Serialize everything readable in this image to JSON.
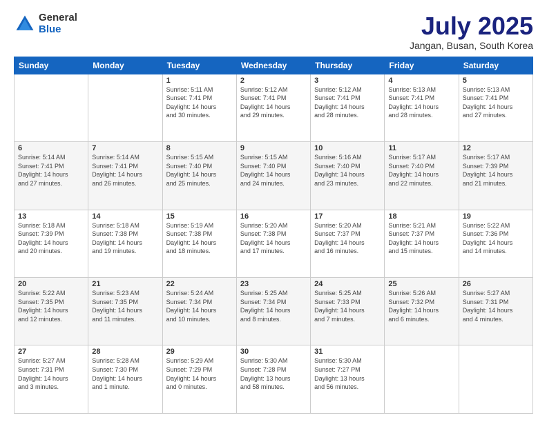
{
  "logo": {
    "general": "General",
    "blue": "Blue"
  },
  "title": "July 2025",
  "location": "Jangan, Busan, South Korea",
  "days_of_week": [
    "Sunday",
    "Monday",
    "Tuesday",
    "Wednesday",
    "Thursday",
    "Friday",
    "Saturday"
  ],
  "weeks": [
    [
      {
        "day": "",
        "content": ""
      },
      {
        "day": "",
        "content": ""
      },
      {
        "day": "1",
        "content": "Sunrise: 5:11 AM\nSunset: 7:41 PM\nDaylight: 14 hours\nand 30 minutes."
      },
      {
        "day": "2",
        "content": "Sunrise: 5:12 AM\nSunset: 7:41 PM\nDaylight: 14 hours\nand 29 minutes."
      },
      {
        "day": "3",
        "content": "Sunrise: 5:12 AM\nSunset: 7:41 PM\nDaylight: 14 hours\nand 28 minutes."
      },
      {
        "day": "4",
        "content": "Sunrise: 5:13 AM\nSunset: 7:41 PM\nDaylight: 14 hours\nand 28 minutes."
      },
      {
        "day": "5",
        "content": "Sunrise: 5:13 AM\nSunset: 7:41 PM\nDaylight: 14 hours\nand 27 minutes."
      }
    ],
    [
      {
        "day": "6",
        "content": "Sunrise: 5:14 AM\nSunset: 7:41 PM\nDaylight: 14 hours\nand 27 minutes."
      },
      {
        "day": "7",
        "content": "Sunrise: 5:14 AM\nSunset: 7:41 PM\nDaylight: 14 hours\nand 26 minutes."
      },
      {
        "day": "8",
        "content": "Sunrise: 5:15 AM\nSunset: 7:40 PM\nDaylight: 14 hours\nand 25 minutes."
      },
      {
        "day": "9",
        "content": "Sunrise: 5:15 AM\nSunset: 7:40 PM\nDaylight: 14 hours\nand 24 minutes."
      },
      {
        "day": "10",
        "content": "Sunrise: 5:16 AM\nSunset: 7:40 PM\nDaylight: 14 hours\nand 23 minutes."
      },
      {
        "day": "11",
        "content": "Sunrise: 5:17 AM\nSunset: 7:40 PM\nDaylight: 14 hours\nand 22 minutes."
      },
      {
        "day": "12",
        "content": "Sunrise: 5:17 AM\nSunset: 7:39 PM\nDaylight: 14 hours\nand 21 minutes."
      }
    ],
    [
      {
        "day": "13",
        "content": "Sunrise: 5:18 AM\nSunset: 7:39 PM\nDaylight: 14 hours\nand 20 minutes."
      },
      {
        "day": "14",
        "content": "Sunrise: 5:18 AM\nSunset: 7:38 PM\nDaylight: 14 hours\nand 19 minutes."
      },
      {
        "day": "15",
        "content": "Sunrise: 5:19 AM\nSunset: 7:38 PM\nDaylight: 14 hours\nand 18 minutes."
      },
      {
        "day": "16",
        "content": "Sunrise: 5:20 AM\nSunset: 7:38 PM\nDaylight: 14 hours\nand 17 minutes."
      },
      {
        "day": "17",
        "content": "Sunrise: 5:20 AM\nSunset: 7:37 PM\nDaylight: 14 hours\nand 16 minutes."
      },
      {
        "day": "18",
        "content": "Sunrise: 5:21 AM\nSunset: 7:37 PM\nDaylight: 14 hours\nand 15 minutes."
      },
      {
        "day": "19",
        "content": "Sunrise: 5:22 AM\nSunset: 7:36 PM\nDaylight: 14 hours\nand 14 minutes."
      }
    ],
    [
      {
        "day": "20",
        "content": "Sunrise: 5:22 AM\nSunset: 7:35 PM\nDaylight: 14 hours\nand 12 minutes."
      },
      {
        "day": "21",
        "content": "Sunrise: 5:23 AM\nSunset: 7:35 PM\nDaylight: 14 hours\nand 11 minutes."
      },
      {
        "day": "22",
        "content": "Sunrise: 5:24 AM\nSunset: 7:34 PM\nDaylight: 14 hours\nand 10 minutes."
      },
      {
        "day": "23",
        "content": "Sunrise: 5:25 AM\nSunset: 7:34 PM\nDaylight: 14 hours\nand 8 minutes."
      },
      {
        "day": "24",
        "content": "Sunrise: 5:25 AM\nSunset: 7:33 PM\nDaylight: 14 hours\nand 7 minutes."
      },
      {
        "day": "25",
        "content": "Sunrise: 5:26 AM\nSunset: 7:32 PM\nDaylight: 14 hours\nand 6 minutes."
      },
      {
        "day": "26",
        "content": "Sunrise: 5:27 AM\nSunset: 7:31 PM\nDaylight: 14 hours\nand 4 minutes."
      }
    ],
    [
      {
        "day": "27",
        "content": "Sunrise: 5:27 AM\nSunset: 7:31 PM\nDaylight: 14 hours\nand 3 minutes."
      },
      {
        "day": "28",
        "content": "Sunrise: 5:28 AM\nSunset: 7:30 PM\nDaylight: 14 hours\nand 1 minute."
      },
      {
        "day": "29",
        "content": "Sunrise: 5:29 AM\nSunset: 7:29 PM\nDaylight: 14 hours\nand 0 minutes."
      },
      {
        "day": "30",
        "content": "Sunrise: 5:30 AM\nSunset: 7:28 PM\nDaylight: 13 hours\nand 58 minutes."
      },
      {
        "day": "31",
        "content": "Sunrise: 5:30 AM\nSunset: 7:27 PM\nDaylight: 13 hours\nand 56 minutes."
      },
      {
        "day": "",
        "content": ""
      },
      {
        "day": "",
        "content": ""
      }
    ]
  ]
}
